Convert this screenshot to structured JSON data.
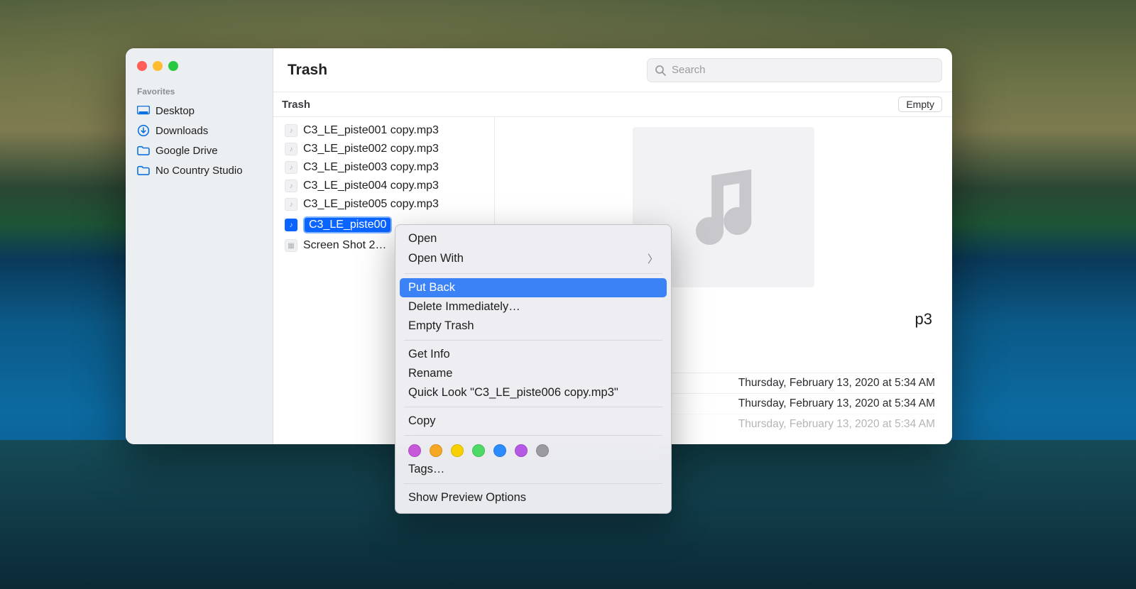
{
  "window": {
    "title": "Trash"
  },
  "sidebar": {
    "section_label": "Favorites",
    "items": [
      {
        "label": "Desktop"
      },
      {
        "label": "Downloads"
      },
      {
        "label": "Google Drive"
      },
      {
        "label": "No Country Studio"
      }
    ]
  },
  "search": {
    "placeholder": "Search"
  },
  "subheader": {
    "label": "Trash",
    "empty_button": "Empty"
  },
  "files": [
    {
      "name": "C3_LE_piste001 copy.mp3",
      "kind": "audio"
    },
    {
      "name": "C3_LE_piste002 copy.mp3",
      "kind": "audio"
    },
    {
      "name": "C3_LE_piste003 copy.mp3",
      "kind": "audio"
    },
    {
      "name": "C3_LE_piste004 copy.mp3",
      "kind": "audio"
    },
    {
      "name": "C3_LE_piste005 copy.mp3",
      "kind": "audio"
    },
    {
      "name": "C3_LE_piste006 copy.mp3",
      "kind": "audio",
      "selected": true,
      "display_truncated": "C3_LE_piste00"
    },
    {
      "name": "Screen Shot 2…",
      "kind": "image"
    }
  ],
  "preview": {
    "filename_suffix_visible": "p3",
    "meta_lines": [
      "Thursday, February 13, 2020 at 5:34 AM",
      "Thursday, February 13, 2020 at 5:34 AM",
      "Thursday, February 13, 2020 at 5:34 AM"
    ]
  },
  "context_menu": {
    "items": [
      {
        "label": "Open"
      },
      {
        "label": "Open With",
        "submenu": true
      },
      {
        "separator": true
      },
      {
        "label": "Put Back",
        "highlighted": true
      },
      {
        "label": "Delete Immediately…"
      },
      {
        "label": "Empty Trash"
      },
      {
        "separator": true
      },
      {
        "label": "Get Info"
      },
      {
        "label": "Rename"
      },
      {
        "label": "Quick Look \"C3_LE_piste006 copy.mp3\""
      },
      {
        "separator": true
      },
      {
        "label": "Copy"
      },
      {
        "separator": true
      },
      {
        "tags": [
          "#c659d9",
          "#f5a623",
          "#f8d000",
          "#4cd964",
          "#2c8cff",
          "#b558e4",
          "#9a9aa0"
        ]
      },
      {
        "label": "Tags…"
      },
      {
        "separator": true
      },
      {
        "label": "Show Preview Options"
      }
    ]
  }
}
